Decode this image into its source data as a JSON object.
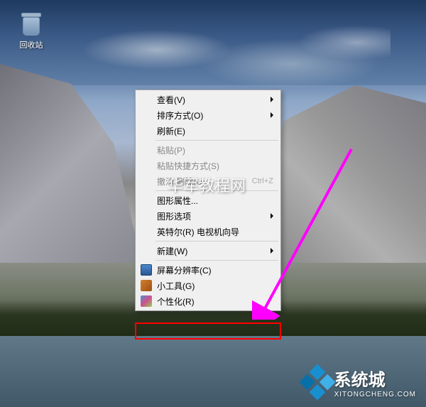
{
  "desktop": {
    "recycle_bin_label": "回收站"
  },
  "context_menu": {
    "items": [
      {
        "label": "查看(V)",
        "has_submenu": true
      },
      {
        "label": "排序方式(O)",
        "has_submenu": true
      },
      {
        "label": "刷新(E)"
      },
      {
        "separator": true
      },
      {
        "label": "粘贴(P)",
        "disabled": true
      },
      {
        "label": "粘贴快捷方式(S)",
        "disabled": true
      },
      {
        "label": "撤消 删除(U)",
        "shortcut": "Ctrl+Z",
        "disabled": true
      },
      {
        "separator": true
      },
      {
        "label": "图形属性..."
      },
      {
        "label": "图形选项",
        "has_submenu": true
      },
      {
        "label": "英特尔(R) 电视机向导"
      },
      {
        "separator": true
      },
      {
        "label": "新建(W)",
        "has_submenu": true
      },
      {
        "separator": true
      },
      {
        "label": "屏幕分辨率(C)",
        "icon": "monitor"
      },
      {
        "label": "小工具(G)",
        "icon": "gadget"
      },
      {
        "label": "个性化(R)",
        "icon": "personalize",
        "highlighted": true
      }
    ]
  },
  "watermark": {
    "center_text": "华军教程网",
    "logo_title": "系统城",
    "logo_url": "XITONGCHENG.COM"
  },
  "highlight": {
    "target_item": "个性化(R)"
  }
}
